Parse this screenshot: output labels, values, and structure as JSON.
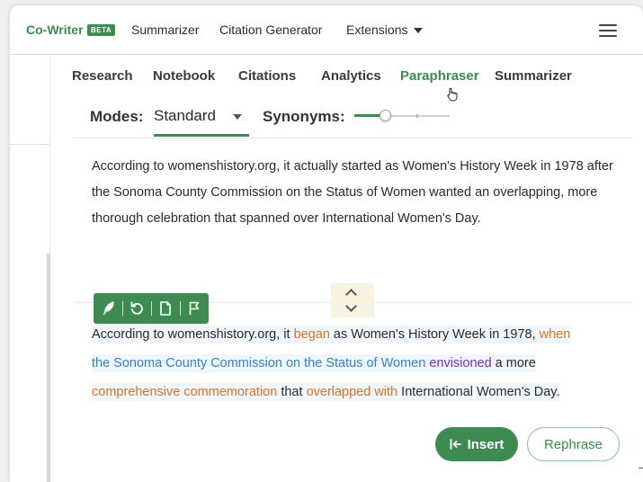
{
  "topbar": {
    "brand": "Co-Writer",
    "badge": "BETA",
    "nav": [
      "Summarizer",
      "Citation Generator",
      "Extensions"
    ]
  },
  "tabs": [
    {
      "label": "Research",
      "active": false
    },
    {
      "label": "Notebook",
      "active": false
    },
    {
      "label": "Citations",
      "active": false
    },
    {
      "label": "Analytics",
      "active": false
    },
    {
      "label": "Paraphraser",
      "active": true
    },
    {
      "label": "Summarizer",
      "active": false
    }
  ],
  "controls": {
    "modes_label": "Modes:",
    "mode_value": "Standard",
    "synonyms_label": "Synonyms:",
    "synonyms_level": 0.33
  },
  "input": {
    "text": "According to womenshistory.org, it actually started as Women's History Week in 1978 after the Sonoma County Commission on the Status of Women wanted an overlapping, more thorough celebration that spanned over International Women's Day."
  },
  "output": {
    "lines": [
      [
        {
          "t": "According to womenshistory.org, it ",
          "k": "plain"
        },
        {
          "t": "began",
          "k": "changed"
        },
        {
          "t": " as Women's History Week in 1978, ",
          "k": "plain"
        },
        {
          "t": "when",
          "k": "changed"
        }
      ],
      [
        {
          "t": "the Sonoma County Commission on the Status of Women",
          "k": "structural"
        },
        {
          "t": " ",
          "k": "plain"
        },
        {
          "t": "envisioned",
          "k": "purple"
        },
        {
          "t": " a more",
          "k": "plain"
        }
      ],
      [
        {
          "t": "comprehensive commemoration",
          "k": "changed"
        },
        {
          "t": " that ",
          "k": "plain"
        },
        {
          "t": "overlapped with",
          "k": "changed"
        },
        {
          "t": " International Women's Day.",
          "k": "plain"
        }
      ]
    ]
  },
  "toolbar_icons": [
    "feather-icon",
    "undo-icon",
    "document-icon",
    "flag-icon"
  ],
  "buttons": {
    "insert": "Insert",
    "rephrase": "Rephrase"
  },
  "colors": {
    "brand_green": "#3d8b50",
    "changed": "#e07020",
    "structural": "#3b7fc4",
    "purple": "#7a2dbd"
  }
}
